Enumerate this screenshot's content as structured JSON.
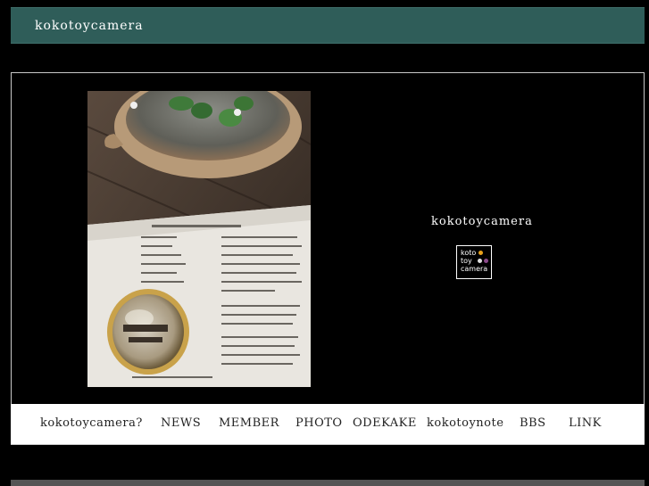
{
  "header": {
    "title": "kokotoycamera"
  },
  "hero": {
    "brand": "kokotoycamera",
    "logo": {
      "line1": "koto",
      "line2": "toy",
      "line3": "camera"
    }
  },
  "nav": {
    "items": [
      {
        "label": "kokotoycamera?"
      },
      {
        "label": "NEWS"
      },
      {
        "label": "MEMBER"
      },
      {
        "label": "PHOTO"
      },
      {
        "label": "ODEKAKE"
      },
      {
        "label": "kokotoynote"
      },
      {
        "label": "BBS"
      },
      {
        "label": "LINK"
      }
    ]
  },
  "colors": {
    "header_bg": "#2f5d59",
    "logo_dot_1": "#e8a21a",
    "logo_dot_2": "#e0e0e0",
    "logo_dot_3": "#8a4a8a"
  }
}
